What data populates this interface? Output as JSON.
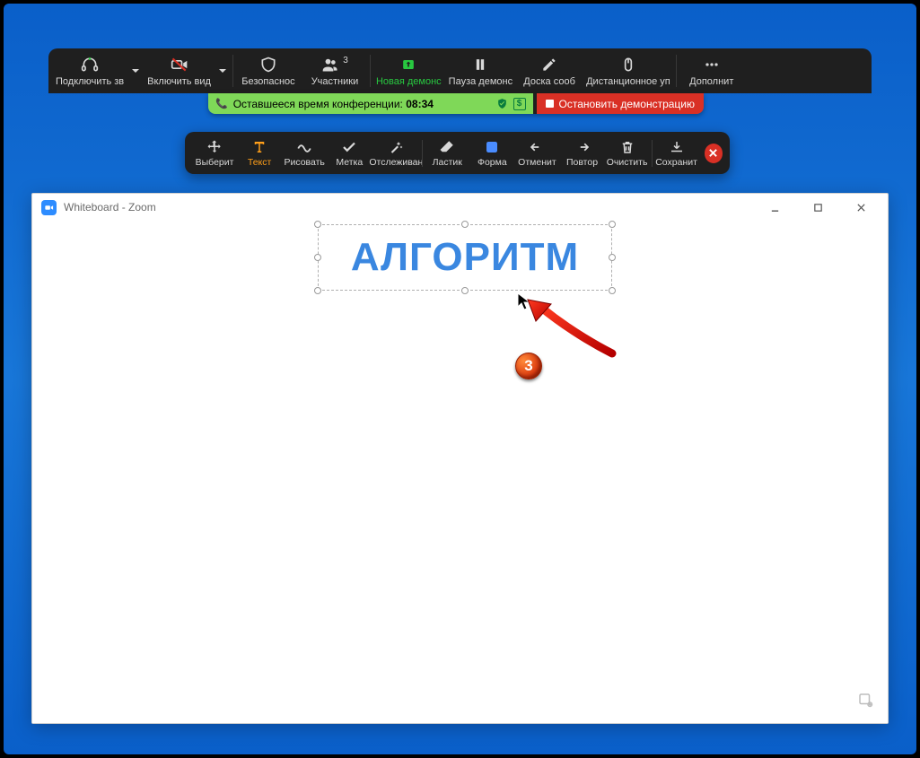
{
  "main_toolbar": {
    "audio": "Подключить зв",
    "video": "Включить вид",
    "security": "Безопаснос",
    "participants": "Участники",
    "participants_count": "3",
    "new_share": "Новая демонс",
    "pause_share": "Пауза демонс",
    "whiteboard": "Доска сооб",
    "remote": "Дистанционное уп",
    "more": "Дополнит"
  },
  "status": {
    "time_label": "Оставшееся время конференции: ",
    "time_value": "08:34",
    "stop_share": "Остановить демонстрацию"
  },
  "anno": {
    "select": "Выберит",
    "text": "Текст",
    "draw": "Рисовать",
    "stamp": "Метка",
    "spotlight": "Отслеживан",
    "eraser": "Ластик",
    "format": "Форма",
    "undo": "Отменит",
    "redo": "Повтор",
    "clear": "Очистить",
    "save": "Сохранит"
  },
  "whiteboard": {
    "title": "Whiteboard - Zoom",
    "text_content": "АЛГОРИТМ"
  },
  "step_number": "3"
}
